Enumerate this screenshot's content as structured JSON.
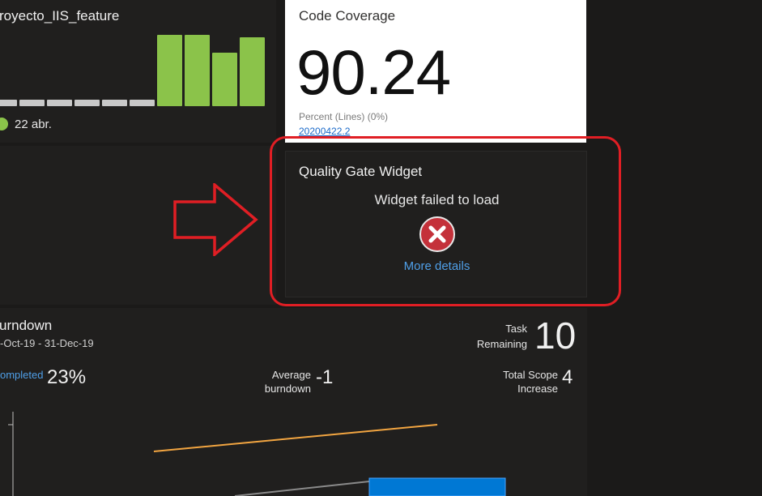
{
  "build": {
    "title": "royecto_IIS_feature",
    "date_label": "22 abr.",
    "bars": [
      {
        "status": "gray"
      },
      {
        "status": "gray"
      },
      {
        "status": "gray"
      },
      {
        "status": "gray"
      },
      {
        "status": "gray"
      },
      {
        "status": "gray"
      },
      {
        "status": "pass",
        "level": 0.97
      },
      {
        "status": "pass",
        "level": 0.97
      },
      {
        "status": "pass",
        "level": 0.72
      },
      {
        "status": "pass",
        "level": 0.93
      }
    ],
    "colors": {
      "pass": "#8bc34a",
      "neutral": "#c8c8c8"
    }
  },
  "coverage": {
    "title": "Code Coverage",
    "value": "90.24",
    "subtitle": "Percent (Lines) (0%)",
    "build_link": "20200422.2"
  },
  "quality_gate": {
    "title": "Quality Gate Widget",
    "message": "Widget failed to load",
    "error_icon": "error-x-icon",
    "details_link": "More details",
    "highlight_color": "#e01e24"
  },
  "burndown": {
    "title": "urndown",
    "date_range": "-Oct-19 - 31-Dec-19",
    "completed_label": "ompleted",
    "completed_value": "23%",
    "average_label_1": "Average",
    "average_label_2": "burndown",
    "average_value": "-1",
    "task_label_1": "Task",
    "task_label_2": "Remaining",
    "task_value": "10",
    "scope_label_1": "Total Scope",
    "scope_label_2": "Increase",
    "scope_value": "4",
    "colors": {
      "scope_line": "#f2a541",
      "bar": "#0078d4",
      "link": "#4f9fe8"
    }
  }
}
